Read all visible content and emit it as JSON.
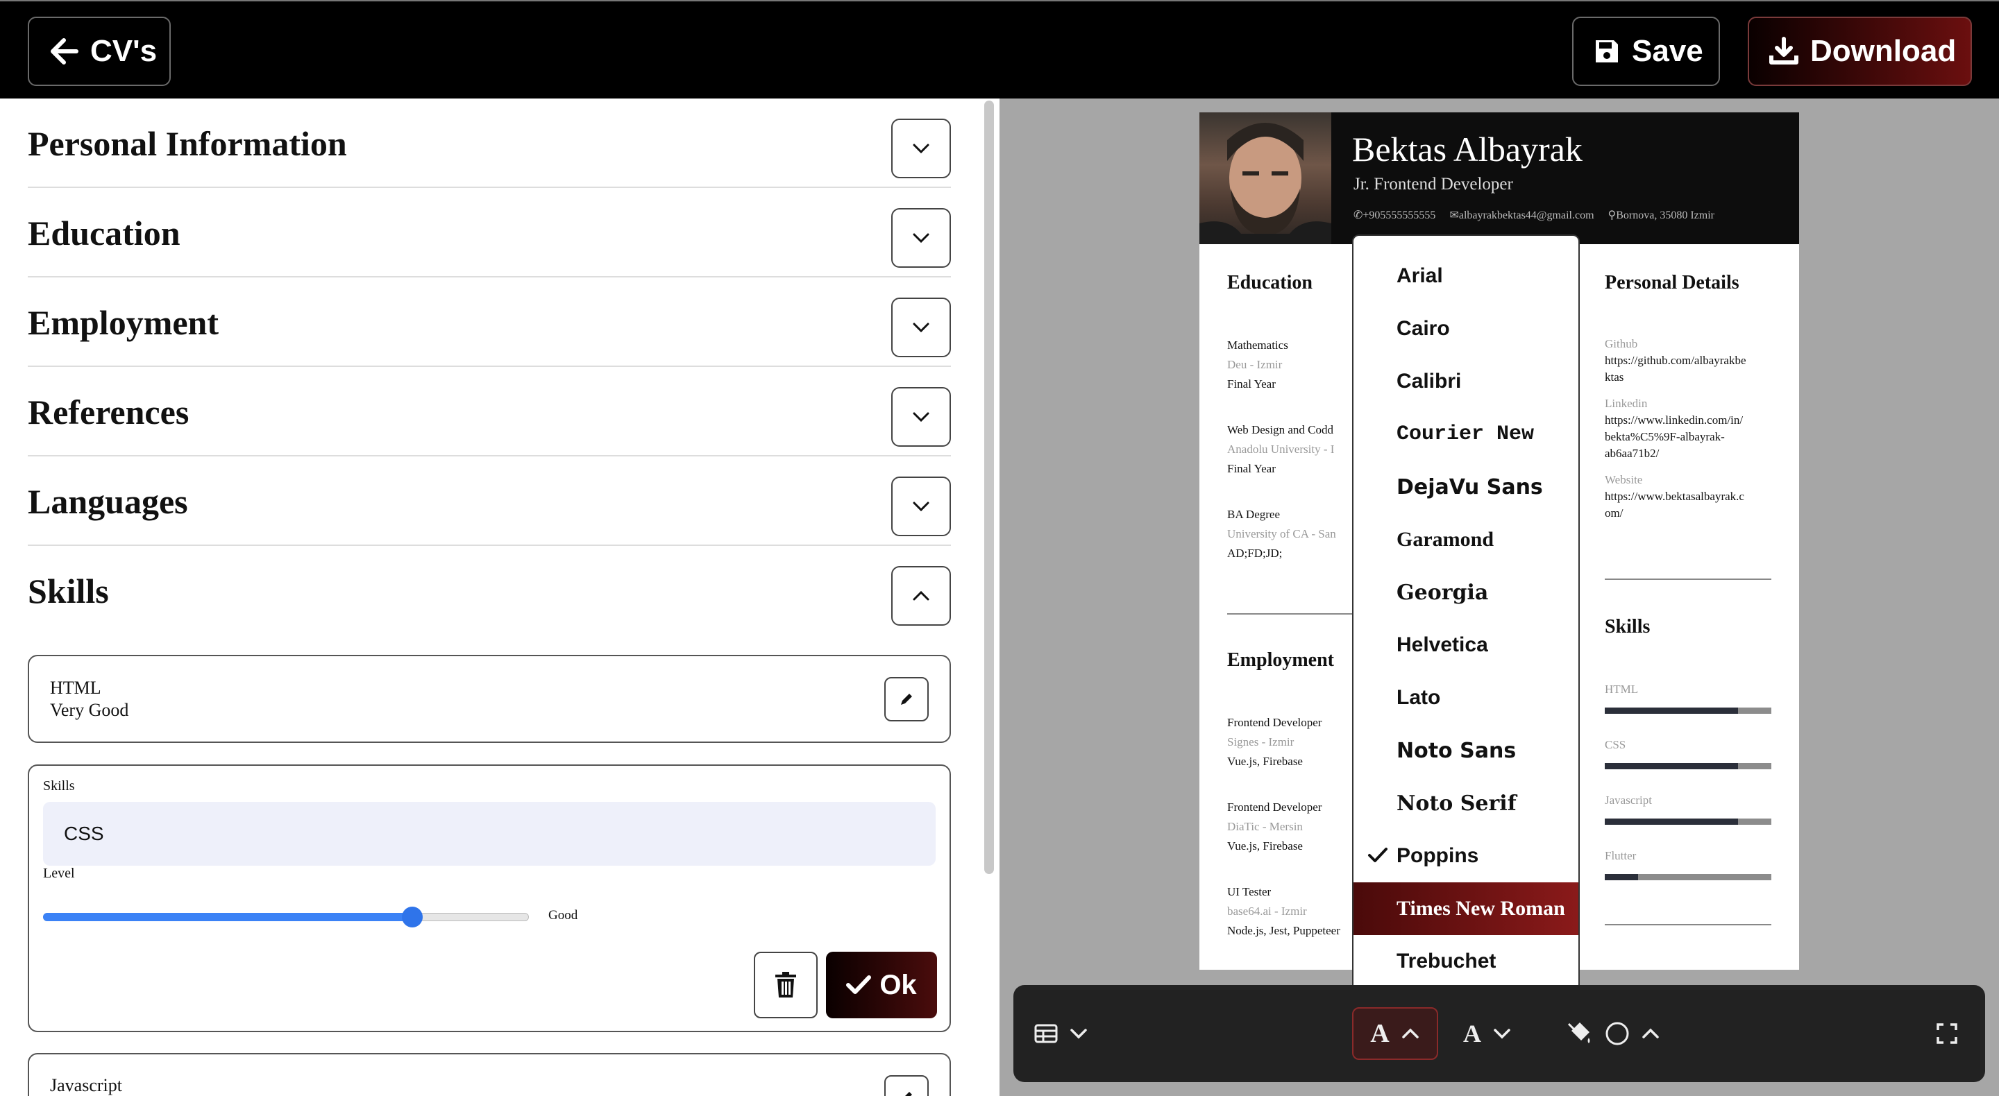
{
  "topbar": {
    "back_label": "CV's",
    "save_label": "Save",
    "download_label": "Download"
  },
  "sections": [
    {
      "title": "Personal Information",
      "expanded": false
    },
    {
      "title": "Education",
      "expanded": false
    },
    {
      "title": "Employment",
      "expanded": false
    },
    {
      "title": "References",
      "expanded": false
    },
    {
      "title": "Languages",
      "expanded": false
    },
    {
      "title": "Skills",
      "expanded": true
    }
  ],
  "skills_editor": {
    "saved_skill": {
      "name": "HTML",
      "level": "Very Good"
    },
    "form": {
      "skills_label": "Skills",
      "skills_value": "CSS",
      "level_label": "Level",
      "level_text": "Good",
      "level_value": 0.76,
      "ok_label": "Ok"
    },
    "next_skill": {
      "name": "Javascript"
    }
  },
  "cv": {
    "name": "Bektas Albayrak",
    "title": "Jr. Frontend Developer",
    "phone": "+905555555555",
    "email": "albayrakbektas44@gmail.com",
    "location": "Bornova, 35080 Izmir",
    "education_title": "Education",
    "education": [
      {
        "line1": "Mathematics",
        "line2": "Deu - Izmir",
        "line3": "Final Year"
      },
      {
        "line1": "Web Design and Codd",
        "line2": "Anadolu University - I",
        "line3": "Final Year"
      },
      {
        "line1": "BA Degree",
        "line2": "University of CA - San",
        "line3": "AD;FD;JD;"
      }
    ],
    "employment_title": "Employment",
    "employment": [
      {
        "line1": "Frontend Developer",
        "line2": "Signes - Izmir",
        "line3": "Vue.js, Firebase"
      },
      {
        "line1": "Frontend Developer",
        "line2": "DiaTic - Mersin",
        "line3": "Vue.js, Firebase"
      },
      {
        "line1": "UI Tester",
        "line2": "base64.ai - Izmir",
        "line3": "Node.js, Jest, Puppeteer"
      }
    ],
    "personal_title": "Personal Details",
    "personal": [
      {
        "label": "Github",
        "value1": "https://github.com/albayrakbe",
        "value2": "ktas"
      },
      {
        "label": "Linkedin",
        "value1": "https://www.linkedin.com/in/",
        "value2": "bekta%C5%9F-albayrak-",
        "value3": "ab6aa71b2/"
      },
      {
        "label": "Website",
        "value1": "https://www.bektasalbayrak.c",
        "value2": "om/"
      }
    ],
    "skills_title": "Skills",
    "skills": [
      {
        "name": "HTML",
        "level": 0.8
      },
      {
        "name": "CSS",
        "level": 0.8
      },
      {
        "name": "Javascript",
        "level": 0.8
      },
      {
        "name": "Flutter",
        "level": 0.2
      }
    ]
  },
  "font_dropdown": {
    "options": [
      "Arial",
      "Cairo",
      "Calibri",
      "Courier New",
      "DejaVu Sans",
      "Garamond",
      "Georgia",
      "Helvetica",
      "Lato",
      "Noto Sans",
      "Noto Serif",
      "Poppins",
      "Times New Roman",
      "Trebuchet"
    ],
    "checked": "Poppins",
    "highlighted": "Times New Roman"
  },
  "toolbar": {
    "icons": [
      "table-layout-icon",
      "font-family-icon",
      "font-size-icon",
      "color-fill-icon",
      "fullscreen-icon"
    ]
  },
  "colors": {
    "accent": "#8b1a1a",
    "slider": "#3b82f6",
    "topbar": "#000000",
    "preview_bg": "#a6a6a6"
  }
}
